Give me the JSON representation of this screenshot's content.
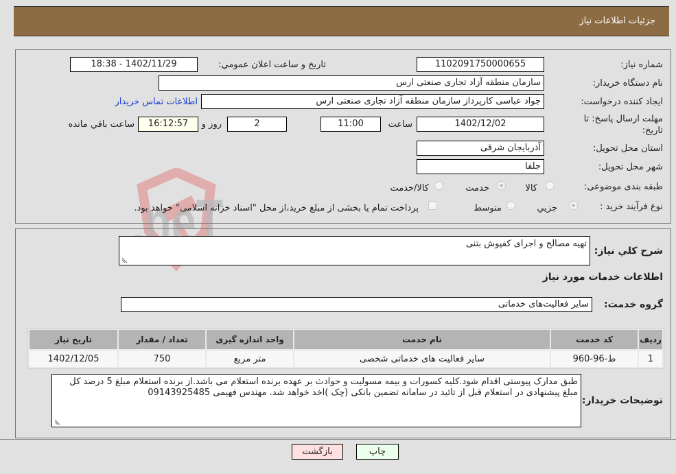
{
  "header": {
    "title": "جزئيات اطلاعات نياز"
  },
  "details": {
    "need_number_label": "شماره نياز:",
    "need_number": "1102091750000655",
    "announce_label": "تاريخ و ساعت اعلان عمومي:",
    "announce_value": "1402/11/29 - 18:38",
    "buyer_org_label": "نام دستگاه خريدار:",
    "buyer_org": "سازمان منطقه آزاد تجاری صنعتی ارس",
    "creator_label": "ايجاد کننده درخواست:",
    "creator": "جواد عباسی کارپرداز سازمان منطقه آزاد تجاری صنعتی ارس",
    "contact_link": "اطلاعات تماس خريدار",
    "deadline_label_line1": "مهلت ارسال پاسخ: تا",
    "deadline_label_line2": "تاريخ:",
    "deadline_date": "1402/12/02",
    "time_label": "ساعت",
    "deadline_time": "11:00",
    "days_remaining": "2",
    "days_label": "روز و",
    "time_remaining": "16:12:57",
    "remaining_label": "ساعت باقي مانده",
    "province_label": "استان محل تحويل:",
    "province": "آذربایجان شرقی",
    "city_label": "شهر محل تحويل:",
    "city": "جلفا",
    "category_label": "طبقه بندی موضوعی:",
    "category_options": [
      {
        "label": "کالا",
        "checked": false
      },
      {
        "label": "خدمت",
        "checked": true
      },
      {
        "label": "کالا/خدمت",
        "checked": false
      }
    ],
    "process_label": "نوع فرآيند خريد :",
    "process_options": [
      {
        "label": "جزيي",
        "checked": true
      },
      {
        "label": "متوسط",
        "checked": false
      }
    ],
    "treasury_note": "پرداخت تمام يا بخشی از مبلغ خريد،از محل \"اسناد خزانه اسلامی\" خواهد بود."
  },
  "need": {
    "summary_label": "شرح کلي نياز:",
    "summary": "تهيه مصالح و اجرای کفپوش بتنی",
    "services_heading": "اطلاعات خدمات مورد نياز",
    "service_group_label": "گروه خدمت:",
    "service_group": "ساير فعاليت‌های خدماتی"
  },
  "table": {
    "headers": [
      "رديف",
      "کد خدمت",
      "نام خدمت",
      "واحد اندازه گيری",
      "تعداد / مقدار",
      "تاريخ نياز"
    ],
    "rows": [
      [
        "1",
        "ط-96-960",
        "ساير فعاليت های خدماتی شخصی",
        "متر مربع",
        "750",
        "1402/12/05"
      ]
    ]
  },
  "buyer_notes": {
    "label": "توضيحات خريدار:",
    "text": "طبق مدارک پیوستی اقدام شود.کلیه کسورات و بیمه مسولیت و حوادث بر عهده برنده استعلام می باشد.از برنده استعلام مبلغ 5 درصد کل مبلغ پیشنهادی در استعلام قبل از تائید در سامانه تضمین بانکی (چک )اخذ خواهد شد. مهندس فهیمی 09143925485"
  },
  "buttons": {
    "print": "چاپ",
    "back": "بازگشت"
  },
  "watermark": {
    "text": "AriaTender.neT",
    "logo_color": "#e8a5a5",
    "text_color": "#b9b9b9"
  }
}
